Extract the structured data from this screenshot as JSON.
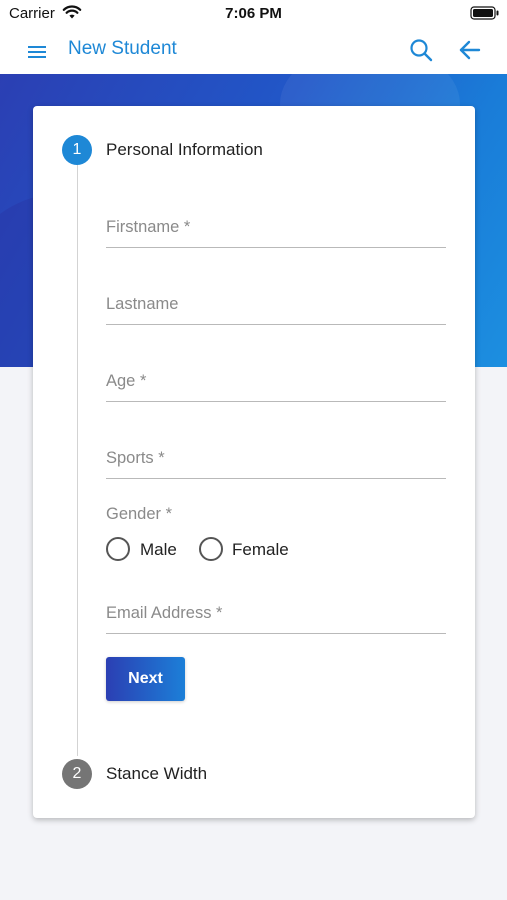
{
  "status_bar": {
    "carrier": "Carrier",
    "time": "7:06 PM",
    "wifi_icon": "wifi-icon",
    "battery_icon": "battery-icon"
  },
  "header": {
    "title": "New Student",
    "menu_icon": "hamburger-menu-icon",
    "search_icon": "search-icon",
    "back_icon": "arrow-left-icon",
    "accent_color": "#1e88d6"
  },
  "stepper": {
    "steps": [
      {
        "number": "1",
        "label": "Personal Information",
        "active": true
      },
      {
        "number": "2",
        "label": "Stance Width",
        "active": false
      }
    ]
  },
  "form": {
    "firstname_placeholder": "Firstname *",
    "lastname_placeholder": "Lastname",
    "age_placeholder": "Age *",
    "sports_placeholder": "Sports *",
    "gender_label": "Gender *",
    "gender_options": [
      "Male",
      "Female"
    ],
    "email_placeholder": "Email Address *",
    "next_label": "Next"
  },
  "colors": {
    "hero_start": "#2b3fb3",
    "hero_end": "#1c8fe0",
    "step_active": "#1e88d6",
    "step_inactive": "#757575"
  }
}
